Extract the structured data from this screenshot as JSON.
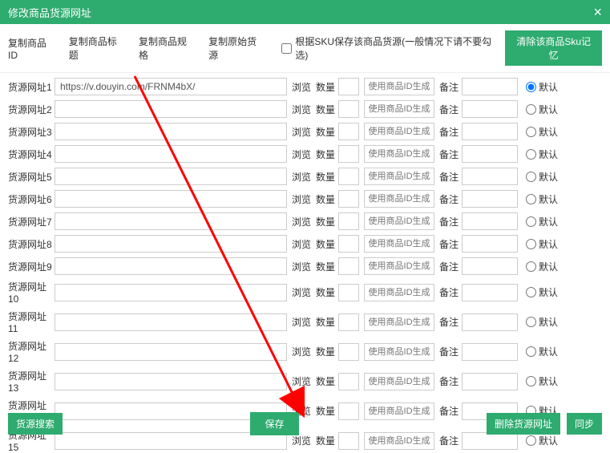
{
  "header": {
    "title": "修改商品货源网址",
    "close": "×"
  },
  "toolbar": {
    "copy_id": "复制商品ID",
    "copy_title": "复制商品标题",
    "copy_spec": "复制商品规格",
    "copy_source": "复制原始货源",
    "sku_checkbox": "根据SKU保存该商品货源(一般情况下请不要勾选)",
    "clear_sku": "清除该商品Sku记忆"
  },
  "row_labels": {
    "browse": "浏览",
    "qty": "数量",
    "gen_placeholder": "使用商品ID生成",
    "note": "备注",
    "default": "默认"
  },
  "rows": [
    {
      "label": "货源网址1",
      "url": "https://v.douyin.com/FRNM4bX/",
      "checked": true
    },
    {
      "label": "货源网址2",
      "url": "",
      "checked": false
    },
    {
      "label": "货源网址3",
      "url": "",
      "checked": false
    },
    {
      "label": "货源网址4",
      "url": "",
      "checked": false
    },
    {
      "label": "货源网址5",
      "url": "",
      "checked": false
    },
    {
      "label": "货源网址6",
      "url": "",
      "checked": false
    },
    {
      "label": "货源网址7",
      "url": "",
      "checked": false
    },
    {
      "label": "货源网址8",
      "url": "",
      "checked": false
    },
    {
      "label": "货源网址9",
      "url": "",
      "checked": false
    },
    {
      "label": "货源网址10",
      "url": "",
      "checked": false
    },
    {
      "label": "货源网址11",
      "url": "",
      "checked": false
    },
    {
      "label": "货源网址12",
      "url": "",
      "checked": false
    },
    {
      "label": "货源网址13",
      "url": "",
      "checked": false
    },
    {
      "label": "货源网址14",
      "url": "",
      "checked": false
    },
    {
      "label": "货源网址15",
      "url": "",
      "checked": false
    }
  ],
  "footer": {
    "search": "货源搜索",
    "save": "保存",
    "delete": "删除货源网址",
    "sync": "同步"
  }
}
